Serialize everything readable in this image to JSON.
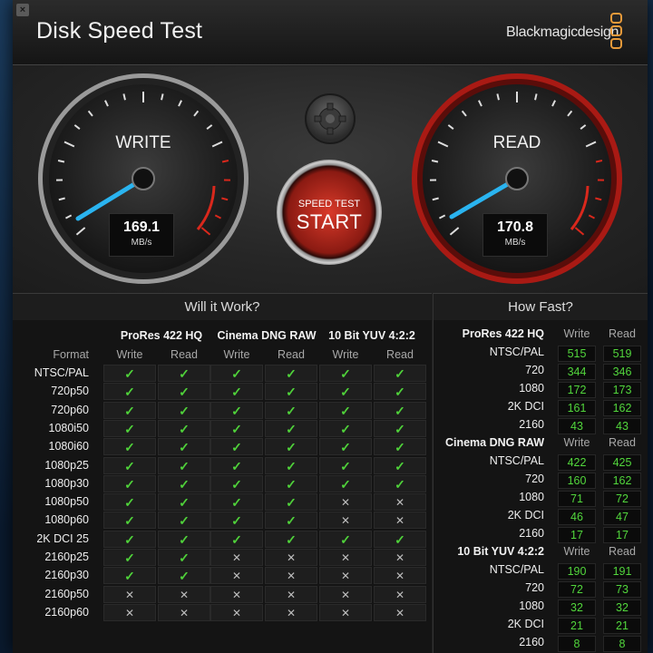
{
  "window": {
    "title": "Disk Speed Test",
    "brand": "Blackmagicdesign",
    "close_glyph": "×"
  },
  "gauges": {
    "write": {
      "label": "WRITE",
      "value": "169.1",
      "unit": "MB/s"
    },
    "read": {
      "label": "READ",
      "value": "170.8",
      "unit": "MB/s"
    }
  },
  "start_button": {
    "small": "SPEED TEST",
    "big": "START"
  },
  "will_it_work": {
    "title": "Will it Work?",
    "format_label": "Format",
    "codecs": [
      "ProRes 422 HQ",
      "Cinema DNG RAW",
      "10 Bit YUV 4:2:2"
    ],
    "sub_headers": [
      "Write",
      "Read"
    ],
    "rows": [
      {
        "format": "NTSC/PAL",
        "cells": [
          1,
          1,
          1,
          1,
          1,
          1
        ]
      },
      {
        "format": "720p50",
        "cells": [
          1,
          1,
          1,
          1,
          1,
          1
        ]
      },
      {
        "format": "720p60",
        "cells": [
          1,
          1,
          1,
          1,
          1,
          1
        ]
      },
      {
        "format": "1080i50",
        "cells": [
          1,
          1,
          1,
          1,
          1,
          1
        ]
      },
      {
        "format": "1080i60",
        "cells": [
          1,
          1,
          1,
          1,
          1,
          1
        ]
      },
      {
        "format": "1080p25",
        "cells": [
          1,
          1,
          1,
          1,
          1,
          1
        ]
      },
      {
        "format": "1080p30",
        "cells": [
          1,
          1,
          1,
          1,
          1,
          1
        ]
      },
      {
        "format": "1080p50",
        "cells": [
          1,
          1,
          1,
          1,
          0,
          0
        ]
      },
      {
        "format": "1080p60",
        "cells": [
          1,
          1,
          1,
          1,
          0,
          0
        ]
      },
      {
        "format": "2K DCI 25",
        "cells": [
          1,
          1,
          1,
          1,
          1,
          1
        ]
      },
      {
        "format": "2160p25",
        "cells": [
          1,
          1,
          0,
          0,
          0,
          0
        ]
      },
      {
        "format": "2160p30",
        "cells": [
          1,
          1,
          0,
          0,
          0,
          0
        ]
      },
      {
        "format": "2160p50",
        "cells": [
          0,
          0,
          0,
          0,
          0,
          0
        ]
      },
      {
        "format": "2160p60",
        "cells": [
          0,
          0,
          0,
          0,
          0,
          0
        ]
      }
    ]
  },
  "how_fast": {
    "title": "How Fast?",
    "col_write": "Write",
    "col_read": "Read",
    "groups": [
      {
        "codec": "ProRes 422 HQ",
        "rows": [
          {
            "format": "NTSC/PAL",
            "write": "515",
            "read": "519"
          },
          {
            "format": "720",
            "write": "344",
            "read": "346"
          },
          {
            "format": "1080",
            "write": "172",
            "read": "173"
          },
          {
            "format": "2K DCI",
            "write": "161",
            "read": "162"
          },
          {
            "format": "2160",
            "write": "43",
            "read": "43"
          }
        ]
      },
      {
        "codec": "Cinema DNG RAW",
        "rows": [
          {
            "format": "NTSC/PAL",
            "write": "422",
            "read": "425"
          },
          {
            "format": "720",
            "write": "160",
            "read": "162"
          },
          {
            "format": "1080",
            "write": "71",
            "read": "72"
          },
          {
            "format": "2K DCI",
            "write": "46",
            "read": "47"
          },
          {
            "format": "2160",
            "write": "17",
            "read": "17"
          }
        ]
      },
      {
        "codec": "10 Bit YUV 4:2:2",
        "rows": [
          {
            "format": "NTSC/PAL",
            "write": "190",
            "read": "191"
          },
          {
            "format": "720",
            "write": "72",
            "read": "73"
          },
          {
            "format": "1080",
            "write": "32",
            "read": "32"
          },
          {
            "format": "2K DCI",
            "write": "21",
            "read": "21"
          },
          {
            "format": "2160",
            "write": "8",
            "read": "8"
          }
        ]
      }
    ]
  },
  "glyphs": {
    "ok": "✓",
    "no": "✕"
  },
  "colors": {
    "accent_green": "#4fd13a",
    "needle_blue": "#2ab4f0",
    "start_red": "#d93a2a",
    "brand_orange": "#e79a3a"
  }
}
